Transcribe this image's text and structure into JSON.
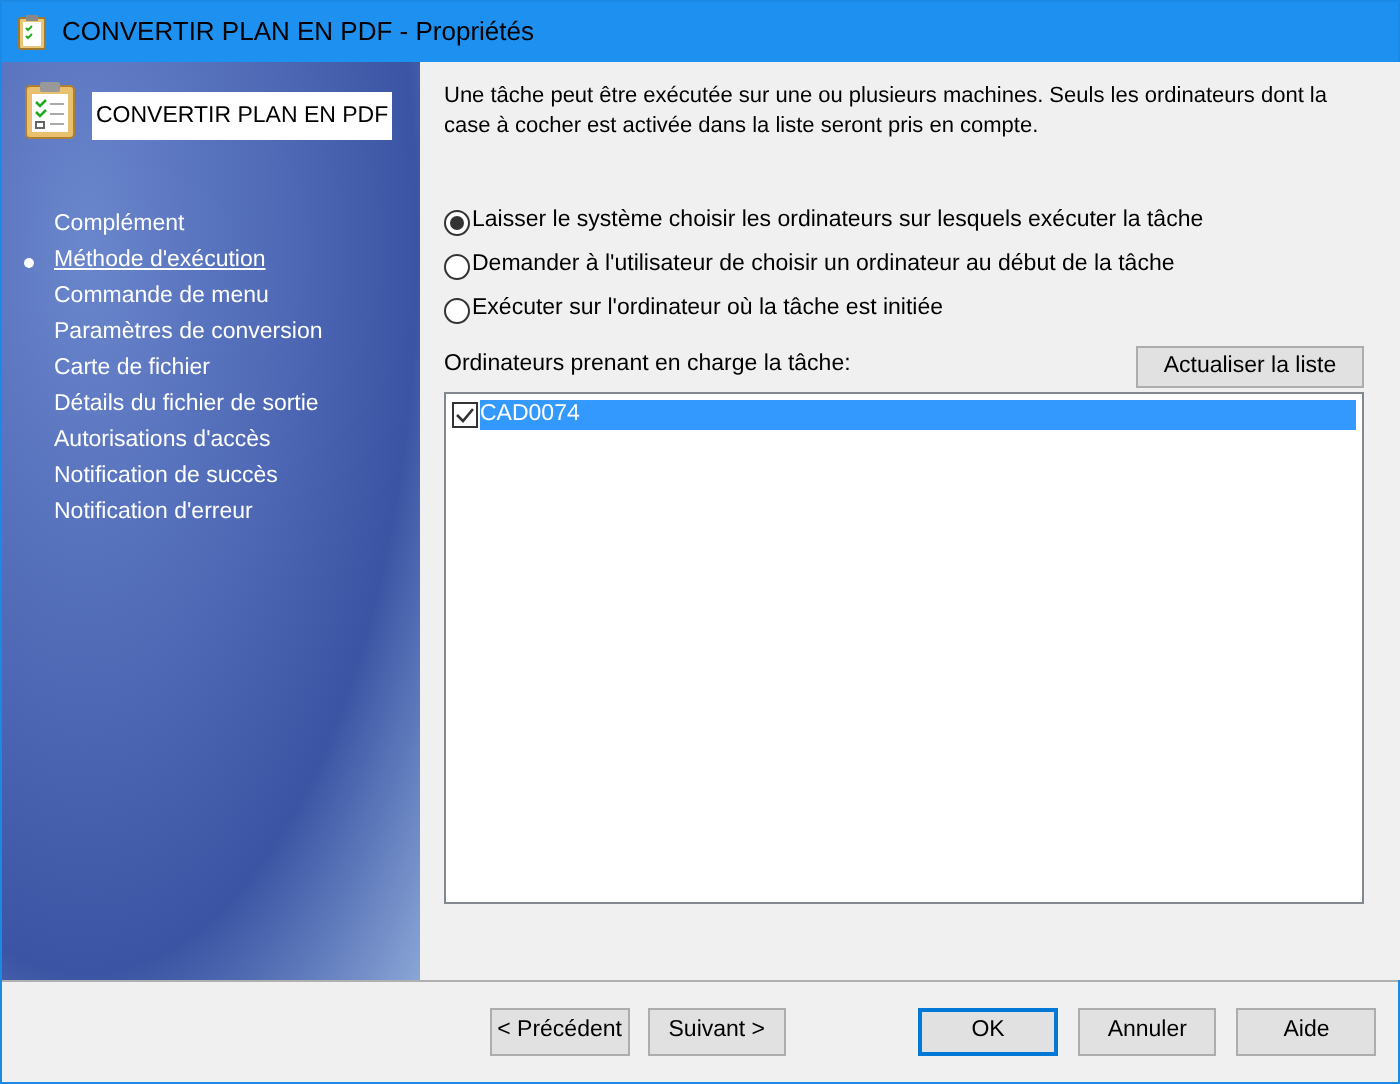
{
  "window": {
    "title": "CONVERTIR PLAN EN PDF - Propriétés"
  },
  "sidebar": {
    "task_name": "CONVERTIR PLAN EN PDF",
    "items": [
      {
        "label": "Complément",
        "selected": false
      },
      {
        "label": "Méthode d'exécution",
        "selected": true
      },
      {
        "label": "Commande de menu",
        "selected": false
      },
      {
        "label": "Paramètres de conversion",
        "selected": false
      },
      {
        "label": "Carte de fichier",
        "selected": false
      },
      {
        "label": "Détails du fichier de sortie",
        "selected": false
      },
      {
        "label": "Autorisations d'accès",
        "selected": false
      },
      {
        "label": "Notification de succès",
        "selected": false
      },
      {
        "label": "Notification d'erreur",
        "selected": false
      }
    ]
  },
  "description": "Une tâche peut être exécutée sur une ou plusieurs machines. Seuls les ordinateurs dont la case à cocher est activée dans la liste seront pris en compte.",
  "options": [
    {
      "label": "Laisser le système choisir les ordinateurs sur lesquels exécuter la tâche",
      "selected": true
    },
    {
      "label": "Demander à l'utilisateur de choisir un ordinateur au début de la tâche",
      "selected": false
    },
    {
      "label": "Exécuter sur l'ordinateur où la tâche est initiée",
      "selected": false
    }
  ],
  "computers": {
    "label": "Ordinateurs prenant en charge la tâche:",
    "refresh_button": "Actualiser la liste",
    "items": [
      {
        "name": "CAD0074",
        "checked": true,
        "selected": true
      }
    ]
  },
  "buttons": [
    {
      "label": "< Précédent",
      "default": false
    },
    {
      "label": "Suivant >",
      "default": false
    },
    {
      "label": "OK",
      "default": true
    },
    {
      "label": "Annuler",
      "default": false
    },
    {
      "label": "Aide",
      "default": false
    }
  ]
}
